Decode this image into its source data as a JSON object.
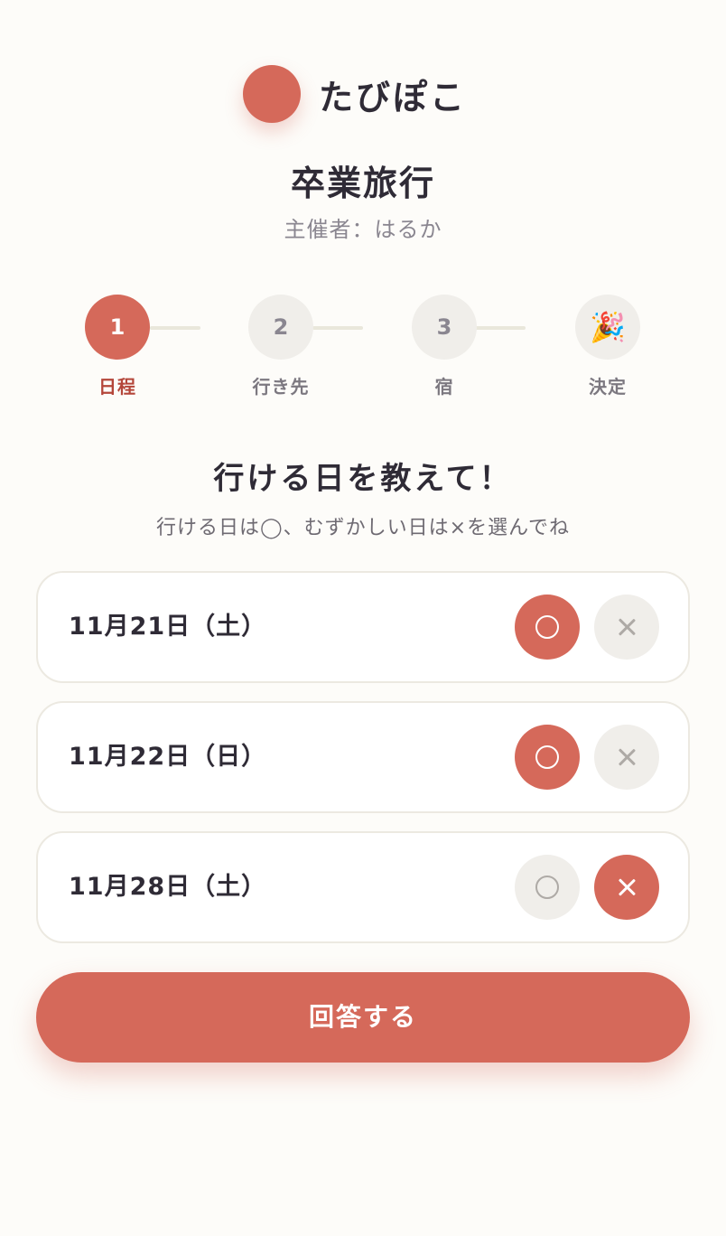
{
  "app": {
    "name": "たびぽこ"
  },
  "event": {
    "title": "卒業旅行",
    "organizer": "主催者：はるか"
  },
  "colors": {
    "accent": "#d5695a",
    "background": "#fdfcf9",
    "inactive": "#f0eeea"
  },
  "stepper": {
    "steps": [
      {
        "number": "1",
        "label": "日程",
        "active": true
      },
      {
        "number": "2",
        "label": "行き先",
        "active": false
      },
      {
        "number": "3",
        "label": "宿",
        "active": false
      },
      {
        "icon": "🎉",
        "icon_name": "party-popper-icon",
        "label": "決定",
        "active": false
      }
    ]
  },
  "question": {
    "title": "行ける日を教えて！",
    "hint": "行ける日は◯、むずかしい日は×を選んでね"
  },
  "dates": [
    {
      "label": "11月21日（土）",
      "answer": "ok"
    },
    {
      "label": "11月22日（日）",
      "answer": "ok"
    },
    {
      "label": "11月28日（土）",
      "answer": "ng"
    }
  ],
  "submit": {
    "label": "回答する"
  }
}
